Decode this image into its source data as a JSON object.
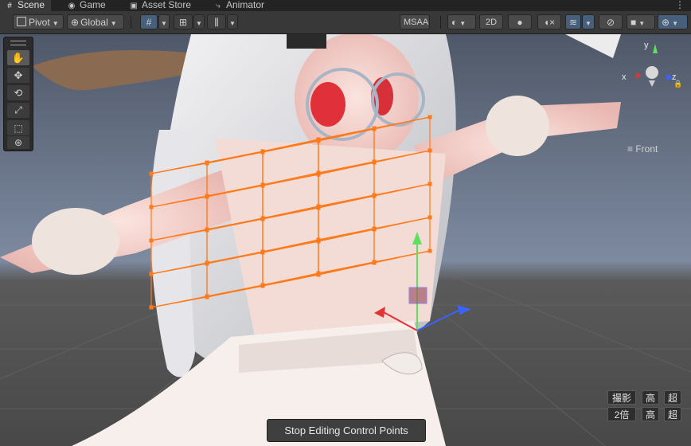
{
  "tabs": [
    {
      "label": "Scene",
      "icon": "hash-icon",
      "active": true
    },
    {
      "label": "Game",
      "icon": "gamepad-icon",
      "active": false
    },
    {
      "label": "Asset Store",
      "icon": "store-icon",
      "active": false
    },
    {
      "label": "Animator",
      "icon": "animator-icon",
      "active": false
    }
  ],
  "toolbar": {
    "pivot_label": "Pivot",
    "global_label": "Global",
    "msaa_label": "MSAA",
    "mode_2d_label": "2D"
  },
  "scene_gizmo": {
    "view_label": "≡ Front",
    "axis_y": "y",
    "axis_x": "x",
    "axis_z": "z"
  },
  "overlay": {
    "row1": [
      "撮影",
      "高",
      "超"
    ],
    "row2": [
      "2倍",
      "高",
      "超"
    ]
  },
  "stop_button_label": "Stop Editing Control Points",
  "colors": {
    "lattice": "#ff7a1a",
    "handle_y": "#5ee05e",
    "handle_x": "#e23434",
    "handle_z": "#3a63ff",
    "toolbar_active": "#46607c"
  }
}
